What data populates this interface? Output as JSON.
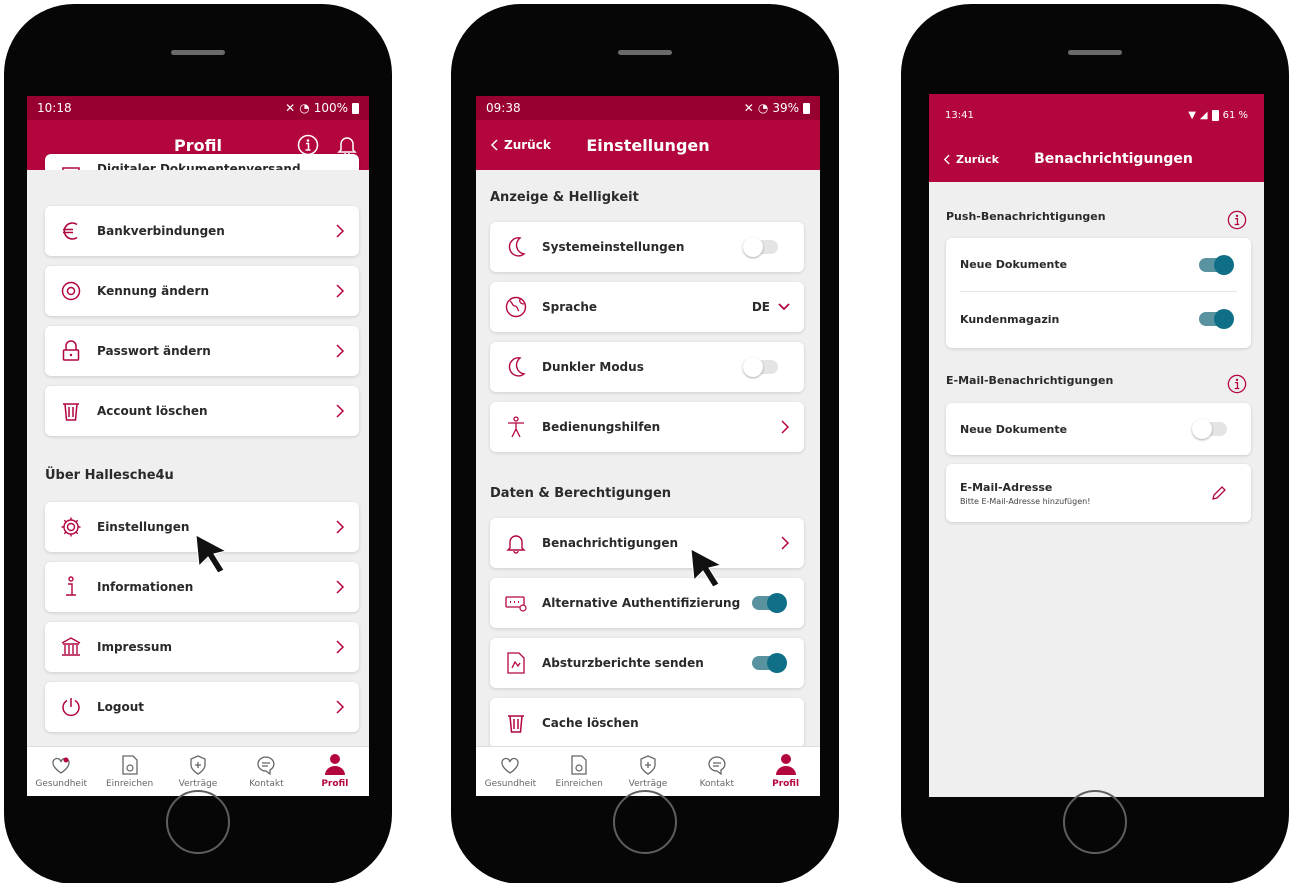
{
  "colors": {
    "brand": "#b2063d",
    "toggle_on": "#0f6f86",
    "background": "#efefef"
  },
  "screen1": {
    "status": {
      "time": "10:18",
      "battery": "100%"
    },
    "header": {
      "title": "Profil"
    },
    "partial_item": "Digitaler Dokumentenversand",
    "items": [
      {
        "label": "Bankverbindungen",
        "icon": "euro-icon"
      },
      {
        "label": "Kennung ändern",
        "icon": "at-icon"
      },
      {
        "label": "Passwort ändern",
        "icon": "lock-icon"
      },
      {
        "label": "Account löschen",
        "icon": "trash-icon"
      }
    ],
    "section_about": "Über Hallesche4u",
    "about_items": [
      {
        "label": "Einstellungen",
        "icon": "gear-icon"
      },
      {
        "label": "Informationen",
        "icon": "info-icon"
      },
      {
        "label": "Impressum",
        "icon": "building-icon"
      },
      {
        "label": "Logout",
        "icon": "power-icon"
      }
    ]
  },
  "screen2": {
    "status": {
      "time": "09:38",
      "battery": "39%"
    },
    "header": {
      "back": "Zurück",
      "title": "Einstellungen"
    },
    "section_display": "Anzeige & Helligkeit",
    "display_items": [
      {
        "label": "Systemeinstellungen",
        "control": "toggle-off"
      },
      {
        "label": "Sprache",
        "value": "DE",
        "control": "dropdown"
      },
      {
        "label": "Dunkler Modus",
        "control": "toggle-off"
      },
      {
        "label": "Bedienungshilfen",
        "control": "chevron"
      }
    ],
    "section_data": "Daten & Berechtigungen",
    "data_items": [
      {
        "label": "Benachrichtigungen",
        "control": "chevron"
      },
      {
        "label": "Alternative Authentifizierung",
        "control": "toggle-on"
      },
      {
        "label": "Absturzberichte senden",
        "control": "toggle-on"
      },
      {
        "label": "Cache löschen",
        "control": "none"
      }
    ]
  },
  "screen3": {
    "status": {
      "time": "13:41",
      "battery": "61 %"
    },
    "header": {
      "back": "Zurück",
      "title": "Benachrichtigungen"
    },
    "section_push": "Push-Benachrichtigungen",
    "push_items": [
      {
        "label": "Neue Dokumente",
        "on": true
      },
      {
        "label": "Kundenmagazin",
        "on": true
      }
    ],
    "section_email": "E-Mail-Benachrichtigungen",
    "email_toggle": {
      "label": "Neue Dokumente",
      "on": false
    },
    "email_address": {
      "label": "E-Mail-Adresse",
      "hint": "Bitte E-Mail-Adresse hinzufügen!"
    }
  },
  "tabbar": [
    {
      "label": "Gesundheit",
      "icon": "heart-icon"
    },
    {
      "label": "Einreichen",
      "icon": "document-icon"
    },
    {
      "label": "Verträge",
      "icon": "shield-icon"
    },
    {
      "label": "Kontakt",
      "icon": "chat-icon"
    },
    {
      "label": "Profil",
      "icon": "person-icon",
      "active": true
    }
  ]
}
